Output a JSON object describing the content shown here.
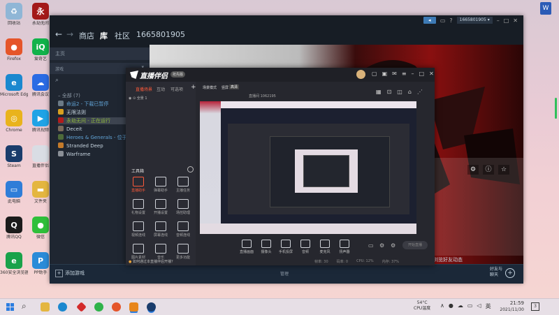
{
  "desktop_icons": [
    {
      "label": "回收站",
      "color": "#8fb6d6",
      "glyph": "♻",
      "icon": "recycle-bin-icon"
    },
    {
      "label": "永劫无间",
      "color": "#a31919",
      "glyph": "永",
      "icon": "game-icon"
    },
    {
      "label": "Firefox",
      "color": "#e5552a",
      "glyph": "●",
      "icon": "firefox-icon"
    },
    {
      "label": "爱奇艺",
      "color": "#11b24a",
      "glyph": "iQ",
      "icon": "iqiyi-icon"
    },
    {
      "label": "Microsoft Edge",
      "color": "#1b88cf",
      "glyph": "e",
      "icon": "edge-icon"
    },
    {
      "label": "腾讯会议",
      "color": "#2a6be4",
      "glyph": "☁",
      "icon": "tencent-meeting-icon"
    },
    {
      "label": "Chrome",
      "color": "#e9b31c",
      "glyph": "◎",
      "icon": "chrome-icon"
    },
    {
      "label": "腾讯视频",
      "color": "#1fa3e6",
      "glyph": "▶",
      "icon": "tencent-video-icon"
    },
    {
      "label": "Steam",
      "color": "#1a3c6b",
      "glyph": "S",
      "icon": "steam-icon"
    },
    {
      "label": "直播伴侣",
      "color": "#d9dde4",
      "glyph": "",
      "icon": "file-icon"
    },
    {
      "label": "此电脑",
      "color": "#2f7dd8",
      "glyph": "▭",
      "icon": "this-pc-icon"
    },
    {
      "label": "文件夹",
      "color": "#e4b640",
      "glyph": "▬",
      "icon": "folder-icon"
    },
    {
      "label": "腾讯QQ",
      "color": "#1b1b1b",
      "glyph": "Q",
      "icon": "qq-icon"
    },
    {
      "label": "微信",
      "color": "#2fbf3a",
      "glyph": "●",
      "icon": "wechat-icon"
    },
    {
      "label": "360安全浏览器",
      "color": "#19a24a",
      "glyph": "e",
      "icon": "browser-icon"
    },
    {
      "label": "PP助手",
      "color": "#2a8bd8",
      "glyph": "P",
      "icon": "pp-icon"
    }
  ],
  "steam": {
    "nav_items": [
      "商店",
      "库",
      "社区",
      "1665801905"
    ],
    "account_badge": "1665801905",
    "side_home": "主页",
    "side_games": "游戏",
    "side_all": "全部",
    "side_all_count": "(7)",
    "games": [
      {
        "name": "命运2 - 下载已暂停",
        "color": "#6b7a86",
        "state": "paused"
      },
      {
        "name": "无限法则",
        "color": "#d8a020",
        "state": "normal"
      },
      {
        "name": "永劫无间 - 正在运行",
        "color": "#b21b1b",
        "state": "running"
      },
      {
        "name": "Deceit",
        "color": "#7b6a5a",
        "state": "normal"
      },
      {
        "name": "Heroes & Generals - 位于队列",
        "color": "#4e6b3a",
        "state": "queued"
      },
      {
        "name": "Stranded Deep",
        "color": "#c47a2a",
        "state": "normal"
      },
      {
        "name": "Warframe",
        "color": "#8a8f96",
        "state": "normal"
      }
    ],
    "add_game": "添加游戏",
    "downloads": "管理",
    "friends": "好友与\n聊天",
    "hero_caption": "浏览好友动态"
  },
  "live": {
    "title": "直播伴侣",
    "version_badge": "抢先版",
    "tabs": [
      "直播场景",
      "互动",
      "可选项"
    ],
    "scene": "全景 1",
    "tools_heading": "工具箱",
    "tools": [
      "直播助手",
      "弹幕助手",
      "主播任务",
      "礼物设置",
      "开播设置",
      "场控助理",
      "视频连线",
      "屏幕连线",
      "音频连线",
      "图片素材",
      "音乐",
      "更多功能"
    ],
    "room_tabs": [
      "场景模式",
      "竖屏",
      "高清"
    ],
    "room_info": "直播间 1062195",
    "controls": [
      "直播画面",
      "摄像头",
      "手机投屏",
      "音频",
      "麦克风",
      "扬声器"
    ],
    "start_button": "开始直播",
    "hint": "如何通过本直播伴侣开播？",
    "status": [
      "帧率: 30",
      "码率: 0",
      "CPU: 12%",
      "内存: 37%"
    ]
  },
  "taskbar": {
    "weather_temp": "54°C",
    "weather_text": "CPU温度",
    "ime": "英",
    "time": "21:59",
    "date": "2021/11/30",
    "notification_count": "3"
  }
}
